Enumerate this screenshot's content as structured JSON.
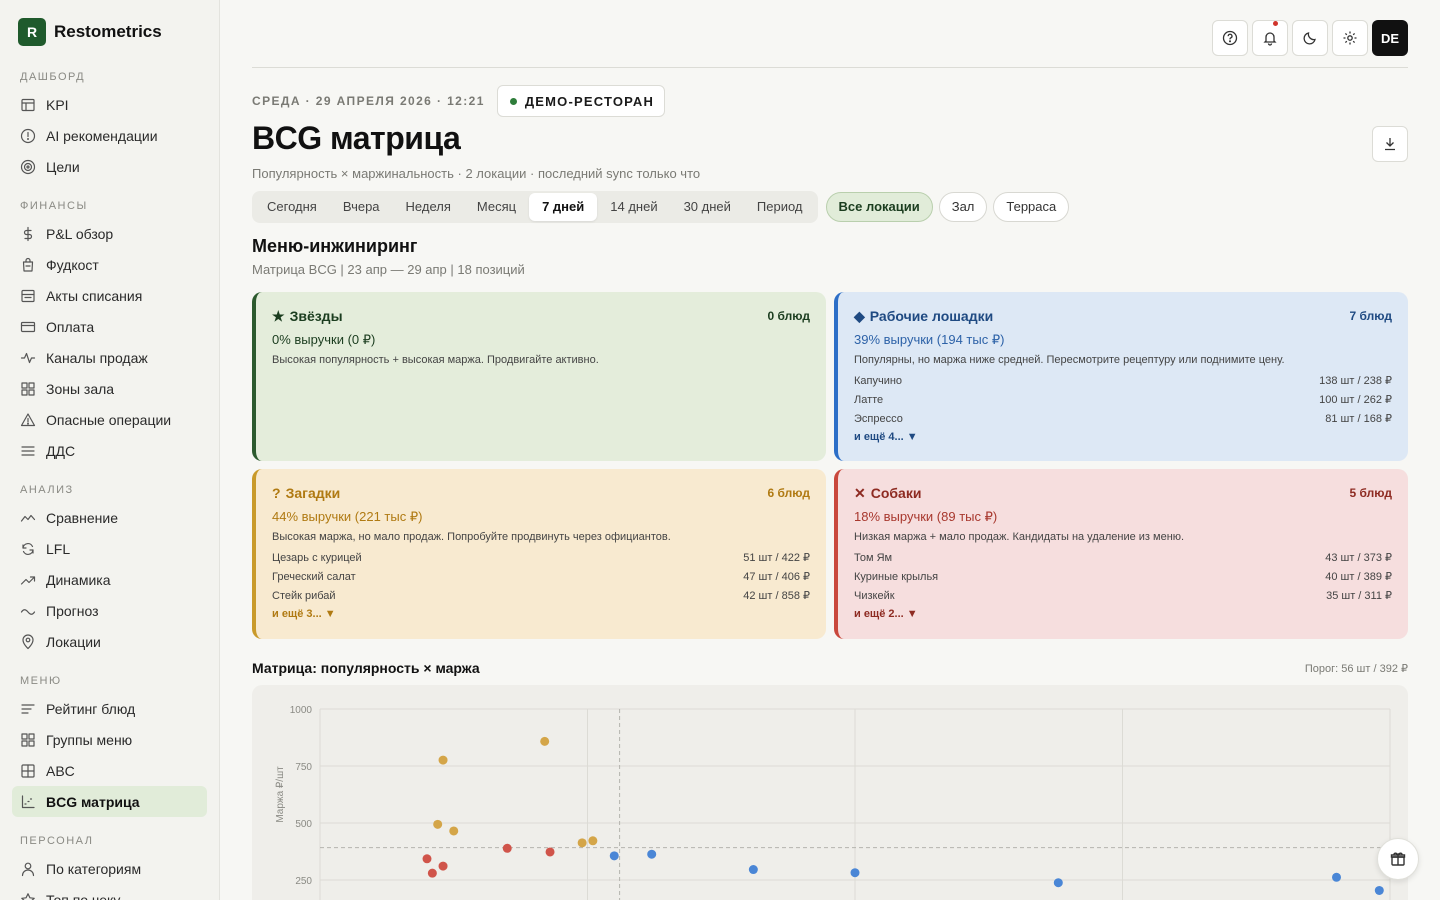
{
  "brand": {
    "logo_letter": "R",
    "name": "Restometrics"
  },
  "sidebar": {
    "sections": [
      {
        "heading": "ДАШБОРД",
        "items": [
          {
            "label": "KPI",
            "icon": "table-icon"
          },
          {
            "label": "AI рекомендации",
            "icon": "alert-circle-icon"
          },
          {
            "label": "Цели",
            "icon": "target-icon"
          }
        ]
      },
      {
        "heading": "ФИНАНСЫ",
        "items": [
          {
            "label": "P&L обзор",
            "icon": "dollar-icon"
          },
          {
            "label": "Фудкост",
            "icon": "bag-icon"
          },
          {
            "label": "Акты списания",
            "icon": "archive-icon"
          },
          {
            "label": "Оплата",
            "icon": "card-icon"
          },
          {
            "label": "Каналы продаж",
            "icon": "activity-icon"
          },
          {
            "label": "Зоны зала",
            "icon": "grid-icon"
          },
          {
            "label": "Опасные операции",
            "icon": "warning-icon"
          },
          {
            "label": "ДДС",
            "icon": "menu-lines-icon"
          }
        ]
      },
      {
        "heading": "АНАЛИЗ",
        "items": [
          {
            "label": "Сравнение",
            "icon": "trend-icon"
          },
          {
            "label": "LFL",
            "icon": "loop-icon"
          },
          {
            "label": "Динамика",
            "icon": "trend-up-icon"
          },
          {
            "label": "Прогноз",
            "icon": "wave-icon"
          },
          {
            "label": "Локации",
            "icon": "pin-icon"
          }
        ]
      },
      {
        "heading": "МЕНЮ",
        "items": [
          {
            "label": "Рейтинг блюд",
            "icon": "list-icon"
          },
          {
            "label": "Группы меню",
            "icon": "grid-icon"
          },
          {
            "label": "ABC",
            "icon": "grid-quad-icon"
          },
          {
            "label": "BCG матрица",
            "icon": "chart-axes-icon",
            "active": true
          }
        ]
      },
      {
        "heading": "ПЕРСОНАЛ",
        "items": [
          {
            "label": "По категориям",
            "icon": "user-icon"
          },
          {
            "label": "Топ по чеку",
            "icon": "star-icon"
          }
        ]
      }
    ]
  },
  "topbar": {
    "avatar": "DE"
  },
  "header": {
    "date": "СРЕДА · 29 АПРЕЛЯ 2026 · 12:21",
    "restaurant": "ДЕМО-РЕСТОРАН",
    "title": "BCG матрица",
    "subtitle": "Популярность × маржинальность · 2 локации · последний sync только что"
  },
  "periods": [
    {
      "label": "Сегодня"
    },
    {
      "label": "Вчера"
    },
    {
      "label": "Неделя"
    },
    {
      "label": "Месяц"
    },
    {
      "label": "7 дней",
      "active": true
    },
    {
      "label": "14 дней"
    },
    {
      "label": "30 дней"
    },
    {
      "label": "Период"
    }
  ],
  "locations": [
    {
      "label": "Все локации",
      "active": true
    },
    {
      "label": "Зал"
    },
    {
      "label": "Терраса"
    }
  ],
  "menu_engineering": {
    "title": "Меню-инжиниринг",
    "subtitle": "Матрица BCG | 23 апр — 29 апр | 18 позиций"
  },
  "quadrants": {
    "stars": {
      "icon": "★",
      "title": "Звёзды",
      "count": "0 блюд",
      "revenue": "0% выручки (0 ₽)",
      "desc": "Высокая популярность + высокая маржа. Продвигайте активно.",
      "rows": [],
      "more": ""
    },
    "horses": {
      "icon": "◆",
      "title": "Рабочие лошадки",
      "count": "7 блюд",
      "revenue": "39% выручки (194 тыс ₽)",
      "desc": "Популярны, но маржа ниже средней. Пересмотрите рецептуру или поднимите цену.",
      "rows": [
        {
          "name": "Капучино",
          "value": "138 шт / 238 ₽"
        },
        {
          "name": "Латте",
          "value": "100 шт / 262 ₽"
        },
        {
          "name": "Эспрессо",
          "value": "81 шт / 168 ₽"
        }
      ],
      "more": "и ещё 4... ▼"
    },
    "puzzles": {
      "icon": "?",
      "title": "Загадки",
      "count": "6 блюд",
      "revenue": "44% выручки (221 тыс ₽)",
      "desc": "Высокая маржа, но мало продаж. Попробуйте продвинуть через официантов.",
      "rows": [
        {
          "name": "Цезарь с курицей",
          "value": "51 шт / 422 ₽"
        },
        {
          "name": "Греческий салат",
          "value": "47 шт / 406 ₽"
        },
        {
          "name": "Стейк рибай",
          "value": "42 шт / 858 ₽"
        }
      ],
      "more": "и ещё 3... ▼"
    },
    "dogs": {
      "icon": "✕",
      "title": "Собаки",
      "count": "5 блюд",
      "revenue": "18% выручки (89 тыс ₽)",
      "desc": "Низкая маржа + мало продаж. Кандидаты на удаление из меню.",
      "rows": [
        {
          "name": "Том Ям",
          "value": "43 шт / 373 ₽"
        },
        {
          "name": "Куриные крылья",
          "value": "40 шт / 389 ₽"
        },
        {
          "name": "Чизкейк",
          "value": "35 шт / 311 ₽"
        }
      ],
      "more": "и ещё 2... ▼"
    }
  },
  "matrix": {
    "title": "Матрица: популярность × маржа",
    "threshold": "Порог: 56 шт / 392 ₽"
  },
  "chart_data": {
    "type": "scatter",
    "ylabel": "Маржа ₽/шт",
    "y_ticks": [
      1000,
      750,
      500,
      250
    ],
    "ylim": [
      0,
      1000
    ],
    "x_threshold": 56,
    "y_threshold": 392,
    "colors": {
      "puzzles": "#d4a548",
      "dogs": "#d0544a",
      "horses": "#4a86d6"
    },
    "series": [
      {
        "name": "Загадки",
        "key": "puzzles",
        "points": [
          [
            42,
            858
          ],
          [
            23,
            776
          ],
          [
            22,
            494
          ],
          [
            25,
            465
          ],
          [
            49,
            413
          ],
          [
            51,
            422
          ]
        ]
      },
      {
        "name": "Собаки",
        "key": "dogs",
        "points": [
          [
            20,
            343
          ],
          [
            21,
            280
          ],
          [
            23,
            311
          ],
          [
            35,
            389
          ],
          [
            43,
            373
          ]
        ]
      },
      {
        "name": "Рабочие лошадки",
        "key": "horses",
        "points": [
          [
            55,
            356
          ],
          [
            62,
            363
          ],
          [
            81,
            296
          ],
          [
            100,
            282
          ],
          [
            138,
            238
          ],
          [
            190,
            262
          ],
          [
            198,
            204
          ]
        ]
      }
    ]
  }
}
